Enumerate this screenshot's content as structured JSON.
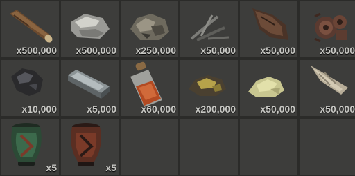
{
  "inventory": {
    "slots": [
      {
        "item": "wood-icon",
        "quantity": "x500,000"
      },
      {
        "item": "stones-icon",
        "quantity": "x500,000"
      },
      {
        "item": "metal-ore-icon",
        "quantity": "x250,000"
      },
      {
        "item": "scrap-sticks-icon",
        "quantity": "x50,000"
      },
      {
        "item": "leather-icon",
        "quantity": "x50,000"
      },
      {
        "item": "gears-icon",
        "quantity": "x50,000"
      },
      {
        "item": "coal-icon",
        "quantity": "x10,000"
      },
      {
        "item": "hq-metal-icon",
        "quantity": "x5,000"
      },
      {
        "item": "gunpowder-jar-icon",
        "quantity": "x60,000"
      },
      {
        "item": "sulfur-ore-icon",
        "quantity": "x200,000"
      },
      {
        "item": "sulfur-icon",
        "quantity": "x50,000"
      },
      {
        "item": "bone-tusk-icon",
        "quantity": "x50,000"
      },
      {
        "item": "green-pot-icon",
        "quantity": "x5"
      },
      {
        "item": "red-pot-icon",
        "quantity": "x5"
      },
      {
        "item": "",
        "quantity": ""
      },
      {
        "item": "",
        "quantity": ""
      },
      {
        "item": "",
        "quantity": ""
      },
      {
        "item": "",
        "quantity": ""
      }
    ]
  }
}
